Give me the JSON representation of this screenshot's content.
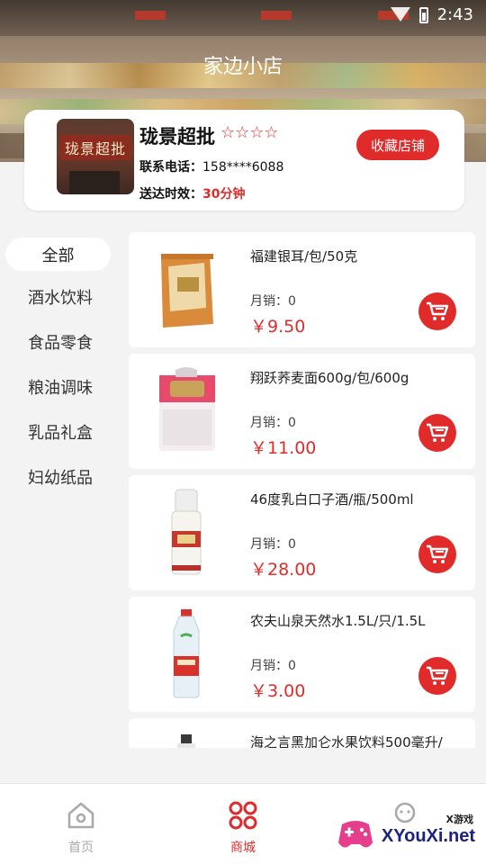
{
  "status_bar": {
    "time": "2:43"
  },
  "header": {
    "title": "家边小店"
  },
  "shop": {
    "name": "珑景超批",
    "rating_stars": 4,
    "star_glyphs": "☆☆☆☆",
    "photo_sign": "珑景超批",
    "favorite_label": "收藏店铺",
    "phone_label": "联系电话：",
    "phone_value": "158****6088",
    "delivery_label": "送达时效：",
    "delivery_value": "30分钟"
  },
  "categories": [
    {
      "label": "全部",
      "active": true
    },
    {
      "label": "酒水饮料"
    },
    {
      "label": "食品零食"
    },
    {
      "label": "粮油调味"
    },
    {
      "label": "乳品礼盒"
    },
    {
      "label": "妇幼纸品"
    }
  ],
  "products": [
    {
      "name": "福建银耳/包/50克",
      "sales": "月销：0",
      "price": "￥9.50"
    },
    {
      "name": "翔跃荞麦面600g/包/600g",
      "sales": "月销：0",
      "price": "￥11.00"
    },
    {
      "name": "46度乳白口子酒/瓶/500ml",
      "sales": "月销：0",
      "price": "￥28.00"
    },
    {
      "name": "农夫山泉天然水1.5L/只/1.5L",
      "sales": "月销：0",
      "price": "￥3.00"
    },
    {
      "name": "海之言黑加仑水果饮料500毫升/",
      "sales": "",
      "price": ""
    }
  ],
  "bottom_nav": [
    {
      "label": "首页",
      "icon": "home-icon"
    },
    {
      "label": "商城",
      "icon": "grid-icon",
      "active": true
    },
    {
      "label": "",
      "icon": "user-icon"
    }
  ],
  "watermark": {
    "top": "X游戏",
    "main": "XYouXi.net"
  },
  "colors": {
    "accent": "#e12b2b",
    "background": "#f3f3f3"
  }
}
